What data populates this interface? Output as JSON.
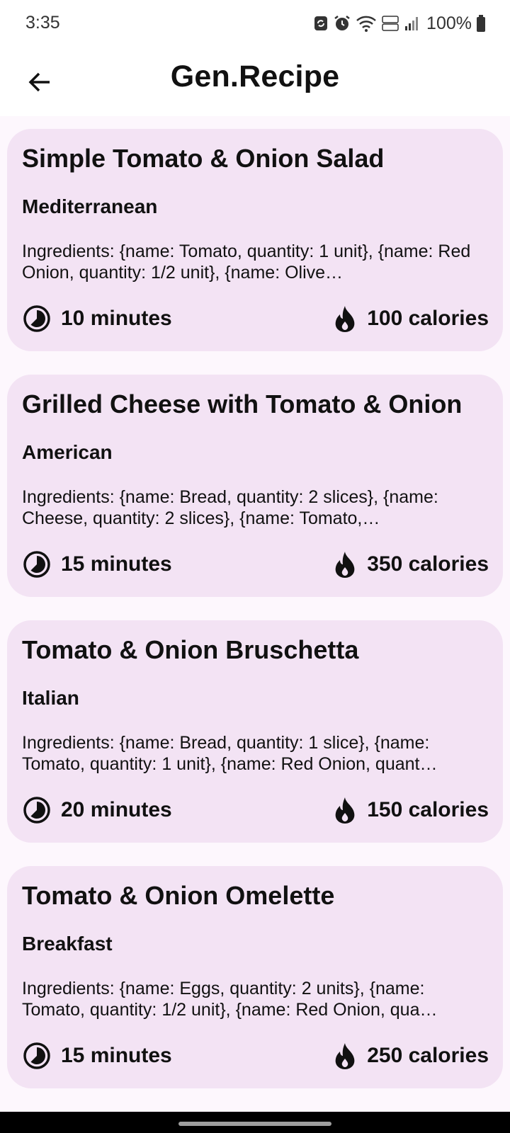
{
  "status_bar": {
    "time": "3:35",
    "battery": "100%",
    "icons": [
      "sync-icon",
      "alarm-icon",
      "wifi-icon",
      "volte-icon",
      "signal-icon",
      "battery-icon"
    ]
  },
  "app_bar": {
    "title": "Gen.Recipe",
    "back_icon": "arrow-left-icon"
  },
  "recipes": [
    {
      "title": "Simple Tomato & Onion Salad",
      "cuisine": "Mediterranean",
      "ingredients": "Ingredients: {name: Tomato, quantity: 1 unit}, {name: Red Onion, quantity: 1/2 unit}, {name: Olive…",
      "time": "10 minutes",
      "calories": "100 calories"
    },
    {
      "title": "Grilled Cheese with Tomato & Onion",
      "cuisine": "American",
      "ingredients": "Ingredients: {name: Bread, quantity: 2 slices}, {name: Cheese, quantity: 2 slices}, {name: Tomato,…",
      "time": "15 minutes",
      "calories": "350 calories"
    },
    {
      "title": "Tomato & Onion Bruschetta",
      "cuisine": "Italian",
      "ingredients": "Ingredients: {name: Bread, quantity: 1 slice}, {name: Tomato, quantity: 1 unit}, {name: Red Onion, quant…",
      "time": "20 minutes",
      "calories": "150 calories"
    },
    {
      "title": "Tomato & Onion Omelette",
      "cuisine": "Breakfast",
      "ingredients": "Ingredients: {name: Eggs, quantity: 2 units}, {name: Tomato, quantity: 1/2 unit}, {name: Red Onion, qua…",
      "time": "15 minutes",
      "calories": "250 calories"
    }
  ],
  "colors": {
    "page_background": "#fdf7fd",
    "card_background": "#f3e3f4",
    "text": "#111111"
  }
}
